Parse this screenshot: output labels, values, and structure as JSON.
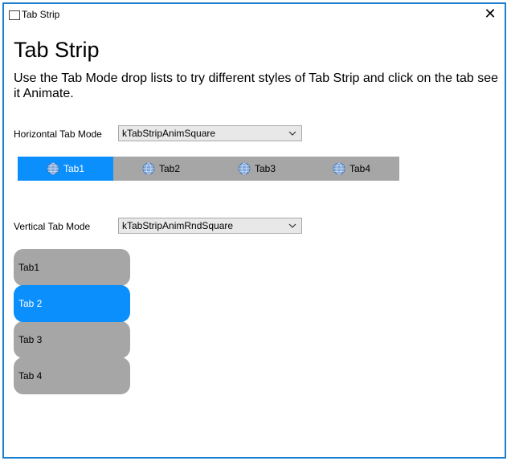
{
  "window": {
    "title": "Tab Strip",
    "close_glyph": "✕"
  },
  "heading": "Tab Strip",
  "description": "Use the Tab Mode drop lists to try different styles of Tab Strip and click on the tab see it Animate.",
  "horizontal": {
    "label": "Horizontal Tab Mode",
    "selected": "kTabStripAnimSquare",
    "active_tab": 0,
    "tabs": [
      {
        "label": "Tab1",
        "icon": "globe-icon"
      },
      {
        "label": "Tab2",
        "icon": "globe-icon"
      },
      {
        "label": "Tab3",
        "icon": "globe-icon"
      },
      {
        "label": "Tab4",
        "icon": "globe-icon"
      }
    ]
  },
  "vertical": {
    "label": "Vertical Tab Mode",
    "selected": "kTabStripAnimRndSquare",
    "active_tab": 1,
    "tabs": [
      {
        "label": "Tab1"
      },
      {
        "label": "Tab 2"
      },
      {
        "label": "Tab 3"
      },
      {
        "label": "Tab 4"
      }
    ]
  },
  "colors": {
    "accent": "#0b8ffc",
    "tab_bg": "#a6a6a6",
    "window_border": "#1b7fd1"
  }
}
